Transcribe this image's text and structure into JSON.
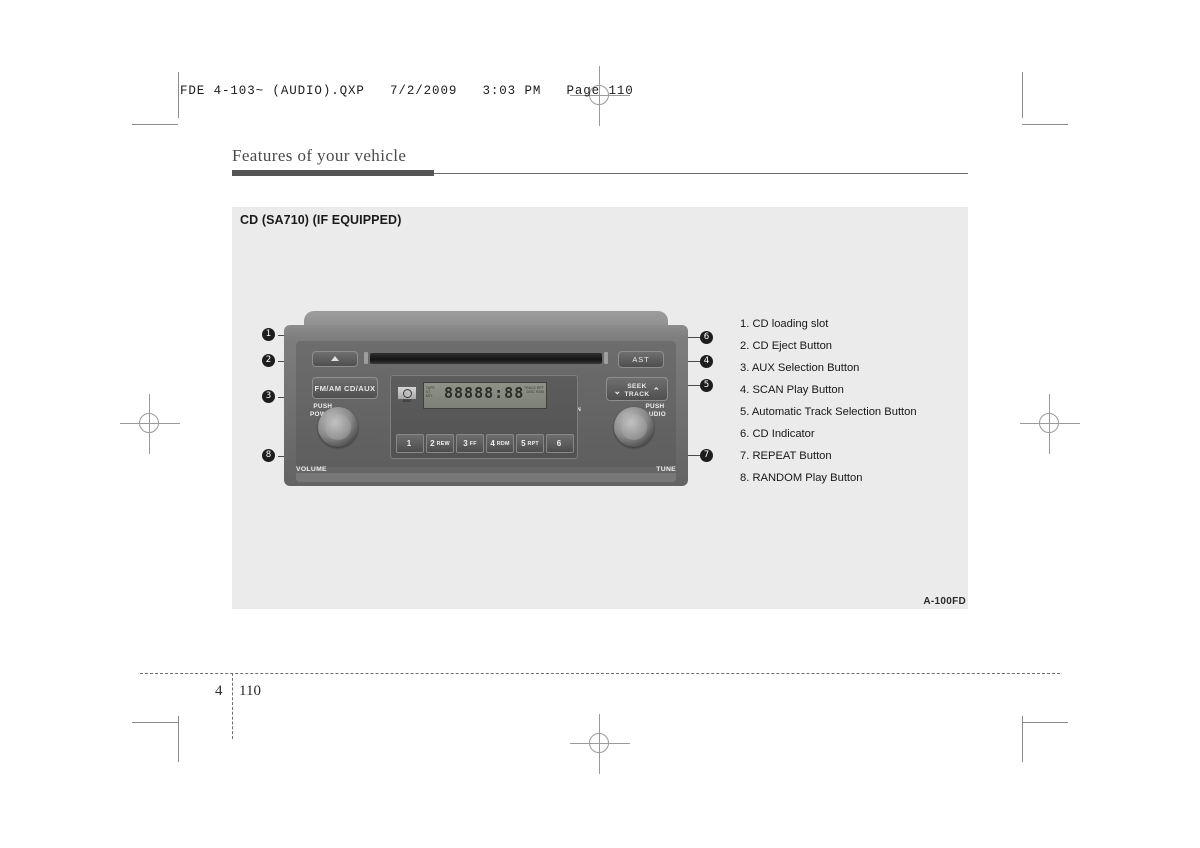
{
  "document": {
    "slug": "FDE 4-103~ (AUDIO).QXP   7/2/2009   3:03 PM   Page 110",
    "chapter_title": "Features of your vehicle",
    "folio_chapter": "4",
    "folio_page": "110"
  },
  "section": {
    "title": "CD (SA710) (IF EQUIPPED)",
    "figure_code": "A-100FD"
  },
  "legend": {
    "items": [
      "1. CD loading slot",
      "2. CD Eject Button",
      "3. AUX Selection Button",
      "4. SCAN Play Button",
      "5. Automatic Track Selection Button",
      "6. CD Indicator",
      "7. REPEAT Button",
      "8. RANDOM Play Button"
    ]
  },
  "callouts": {
    "left": [
      "❶",
      "❷",
      "❸",
      "❽"
    ],
    "right": [
      "❻",
      "❹",
      "❺",
      "❼"
    ],
    "n1": "1",
    "n2": "2",
    "n3": "3",
    "n4": "4",
    "n5": "5",
    "n6": "6",
    "n7": "7",
    "n8": "8"
  },
  "radio": {
    "eject_label": "",
    "source_button": "FM/AM CD/AUX",
    "ast_button": "AST",
    "seek_label_top": "SEEK",
    "seek_label_bottom": "TRACK",
    "chevron_left": "⌄",
    "chevron_right": "⌃",
    "push_power": "PUSH\nPOWER",
    "push_power_line1": "PUSH",
    "push_power_line2": "POWER",
    "push_audio_line1": "PUSH",
    "push_audio_line2": "AUDIO",
    "volume_label": "VOLUME",
    "tune_label": "TUNE",
    "cd_in_label": "CD-IN",
    "cd_logo_line1": "COMPACT",
    "cd_logo_line2": "DISC",
    "lcd": {
      "main": "88888:88",
      "left_flags": "TAPE\nST\nMETAL",
      "right_flags": "TRACK  RPT\nDISC  RDM",
      "secondary": "88"
    },
    "presets": [
      {
        "num": "1",
        "fn": ""
      },
      {
        "num": "2",
        "fn": "REW"
      },
      {
        "num": "3",
        "fn": "FF"
      },
      {
        "num": "4",
        "fn": "RDM"
      },
      {
        "num": "5",
        "fn": "RPT"
      },
      {
        "num": "6",
        "fn": ""
      }
    ]
  },
  "colors": {
    "panel_bg": "#ebebeb",
    "rule": "#555555",
    "text": "#171717",
    "callout_bg": "#1d1d1d"
  }
}
